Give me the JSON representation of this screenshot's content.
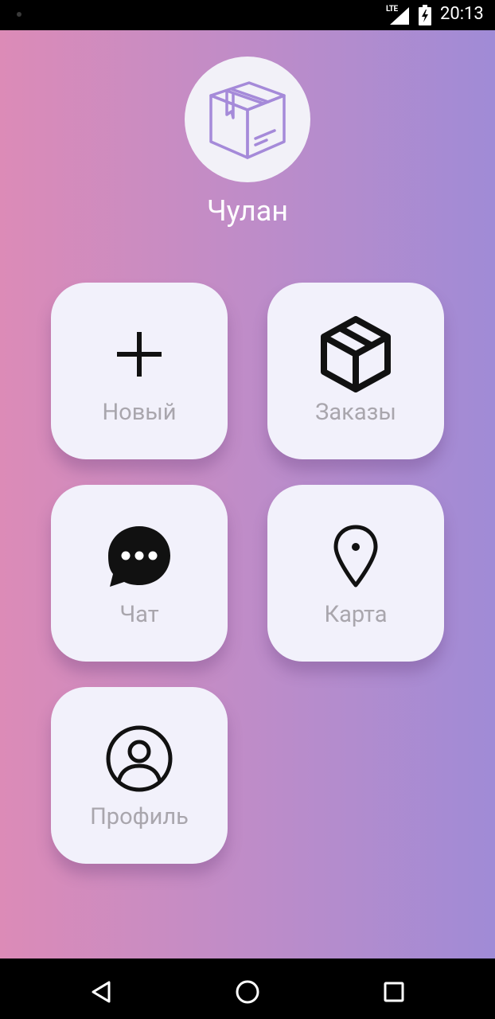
{
  "status_bar": {
    "network": "LTE",
    "time": "20:13"
  },
  "app": {
    "title": "Чулан",
    "logo_icon": "package-icon"
  },
  "tiles": [
    {
      "label": "Новый",
      "icon": "plus-icon"
    },
    {
      "label": "Заказы",
      "icon": "box-icon"
    },
    {
      "label": "Чат",
      "icon": "chat-bubble-icon"
    },
    {
      "label": "Карта",
      "icon": "map-pin-icon"
    },
    {
      "label": "Профиль",
      "icon": "user-circle-icon"
    }
  ],
  "nav": {
    "back_icon": "back-triangle-icon",
    "home_icon": "home-circle-icon",
    "recents_icon": "recents-square-icon"
  },
  "colors": {
    "gradient_left": "#dc8bb7",
    "gradient_right": "#a08bd6",
    "tile_bg": "#f2f1fb",
    "label_gray": "#a9a6ad",
    "logo_purple": "#a58ad9"
  }
}
